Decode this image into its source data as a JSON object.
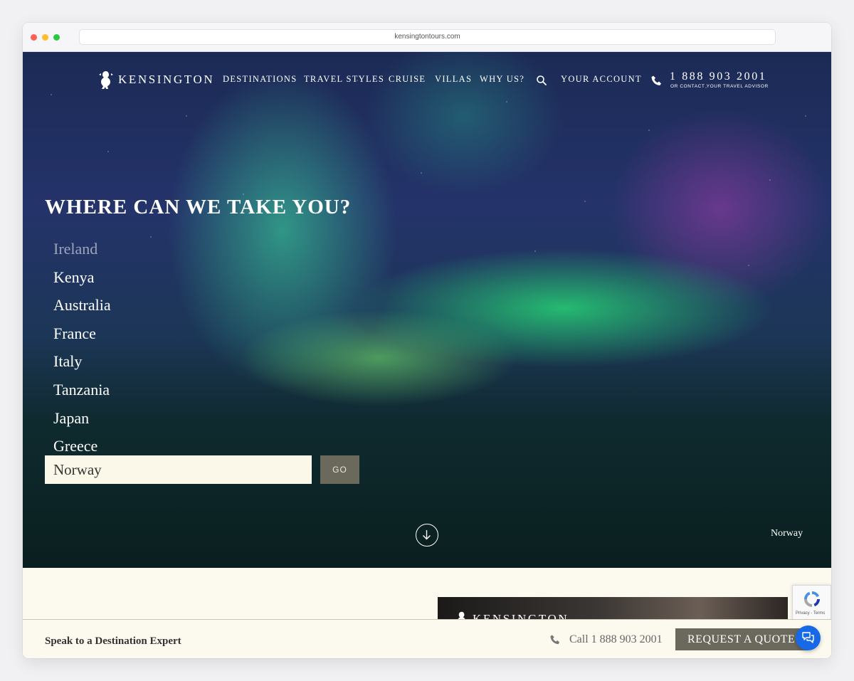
{
  "browser": {
    "url": "kensingtontours.com"
  },
  "colors": {
    "accent_button": "#6b695c",
    "cream": "#fcf9ee",
    "chat_blue": "#1769e6"
  },
  "nav": {
    "logo_text": "KENSINGTON",
    "logo_icon": "lion-crest-icon",
    "items": [
      "DESTINATIONS",
      "TRAVEL STYLES",
      "CRUISE",
      "VILLAS",
      "WHY US?",
      "YOUR ACCOUNT"
    ],
    "search_icon": "search-icon",
    "phone_number": "1 888 903 2001",
    "phone_sub": "OR CONTACT YOUR TRAVEL ADVISOR"
  },
  "hero": {
    "title": "WHERE CAN WE TAKE YOU?",
    "destinations": [
      "Ireland",
      "Kenya",
      "Australia",
      "France",
      "Italy",
      "Tanzania",
      "Japan",
      "Greece"
    ],
    "search_value": "Norway",
    "go_label": "GO",
    "image_caption": "Norway"
  },
  "promo": {
    "logo_text": "KENSINGTON"
  },
  "recaptcha": {
    "text": "Privacy - Terms"
  },
  "footer": {
    "title": "Speak to a Destination Expert",
    "call_text": "Call 1 888 903 2001",
    "quote_label": "REQUEST A QUOTE"
  }
}
